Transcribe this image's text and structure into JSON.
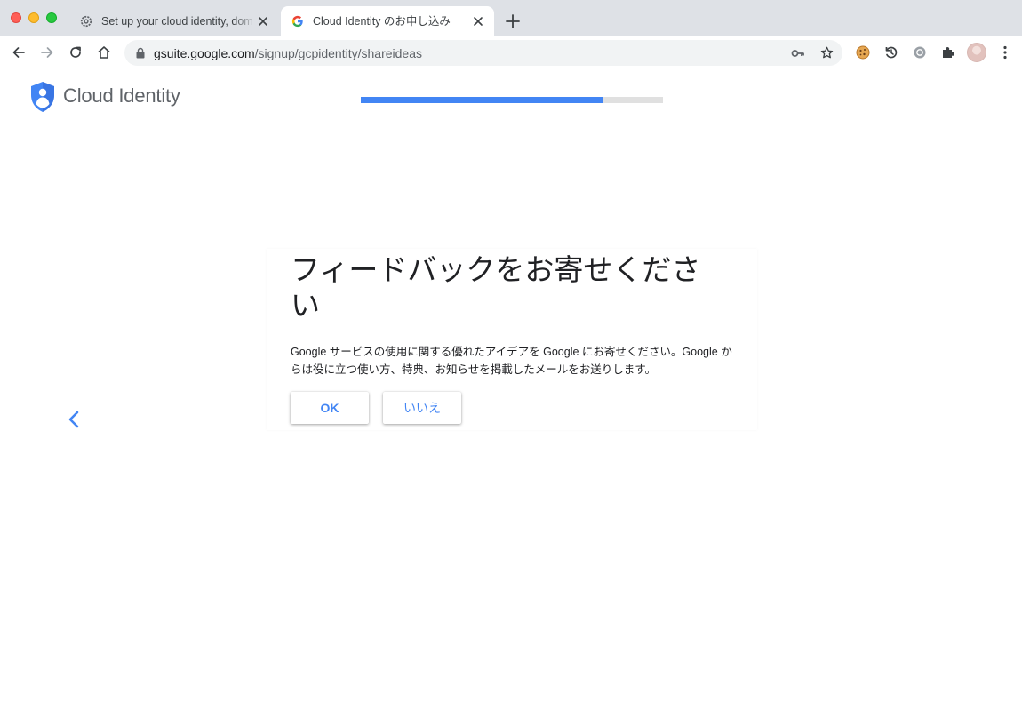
{
  "browser": {
    "tabs": [
      {
        "title": "Set up your cloud identity, dom",
        "active": false
      },
      {
        "title": "Cloud Identity のお申し込み",
        "active": true
      }
    ],
    "url": {
      "host": "gsuite.google.com",
      "path": "/signup/gcpidentity/shareideas"
    }
  },
  "header": {
    "product_name": "Cloud Identity",
    "progress_fraction": 0.8
  },
  "card": {
    "title": "フィードバックをお寄せください",
    "description": "Google サービスの使用に関する優れたアイデアを Google にお寄せください。Google からは役に立つ使い方、特典、お知らせを掲載したメールをお送りします。",
    "ok_label": "OK",
    "no_label": "いいえ"
  },
  "colors": {
    "accent": "#4285f4",
    "progress_track": "#e0e0e0",
    "logo_blue": "#4285f4"
  }
}
